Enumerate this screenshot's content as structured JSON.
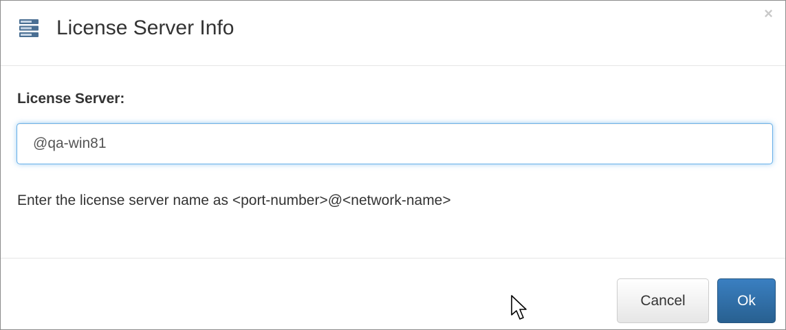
{
  "dialog": {
    "title": "License Server Info",
    "close_glyph": "×",
    "icon": "server-icon"
  },
  "form": {
    "label": "License Server:",
    "value": "@qa-win81",
    "help": "Enter the license server name as <port-number>@<network-name>"
  },
  "footer": {
    "cancel_label": "Cancel",
    "ok_label": "Ok"
  },
  "colors": {
    "ok_button": "#337ab7",
    "focus_border": "#66afe9",
    "cancel_button": "#f0f0f0"
  }
}
